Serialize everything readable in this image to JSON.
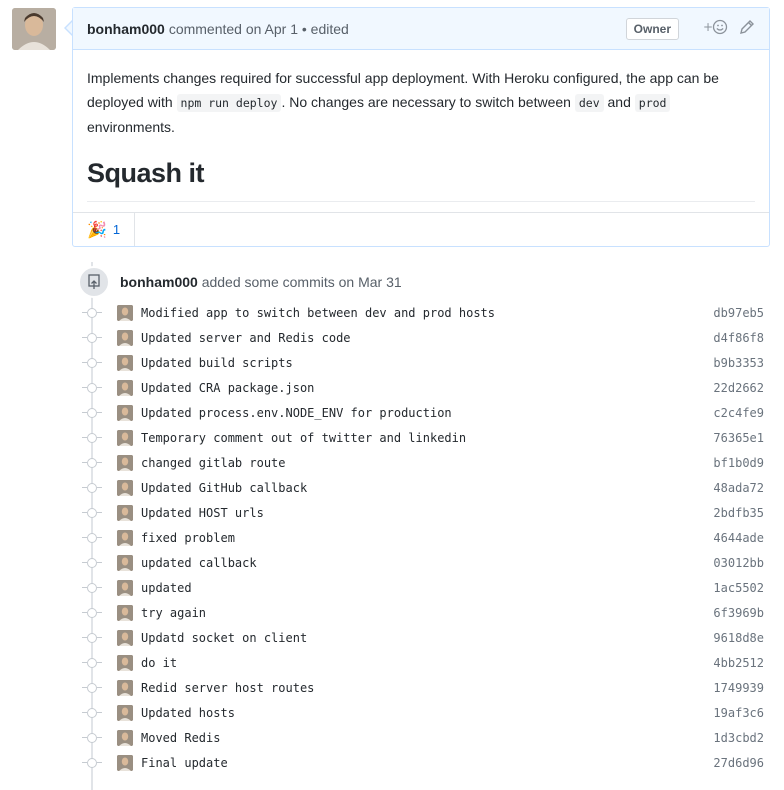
{
  "comment": {
    "author": "bonham000",
    "meta": "commented on Apr 1 • edited",
    "owner_badge": "Owner",
    "emoji_icon": "smiley-add-icon",
    "edit_icon": "pencil-icon",
    "body": {
      "p1_a": "Implements changes required for successful app deployment. With Heroku configured, the app can be deployed with ",
      "code1": "npm run deploy",
      "p1_b": ". No changes are necessary to switch between ",
      "code2": "dev",
      "p1_c": " and ",
      "code3": "prod",
      "p1_d": " environments.",
      "heading": "Squash it"
    },
    "reaction": {
      "emoji": "🎉",
      "count": "1"
    }
  },
  "commits_event": {
    "author": "bonham000",
    "text": "added some commits on Mar 31"
  },
  "commits": [
    {
      "message": "Modified app to switch between dev and prod hosts",
      "sha": "db97eb5"
    },
    {
      "message": "Updated server and Redis code",
      "sha": "d4f86f8"
    },
    {
      "message": "Updated build scripts",
      "sha": "b9b3353"
    },
    {
      "message": "Updated CRA package.json",
      "sha": "22d2662"
    },
    {
      "message": "Updated process.env.NODE_ENV for production",
      "sha": "c2c4fe9"
    },
    {
      "message": "Temporary comment out of twitter and linkedin",
      "sha": "76365e1"
    },
    {
      "message": "changed gitlab route",
      "sha": "bf1b0d9"
    },
    {
      "message": "Updated GitHub callback",
      "sha": "48ada72"
    },
    {
      "message": "Updated HOST urls",
      "sha": "2bdfb35"
    },
    {
      "message": "fixed problem",
      "sha": "4644ade"
    },
    {
      "message": "updated callback",
      "sha": "03012bb"
    },
    {
      "message": "updated",
      "sha": "1ac5502"
    },
    {
      "message": "try again",
      "sha": "6f3969b"
    },
    {
      "message": "Updatd socket on client",
      "sha": "9618d8e"
    },
    {
      "message": "do it",
      "sha": "4bb2512"
    },
    {
      "message": "Redid server host routes",
      "sha": "1749939"
    },
    {
      "message": "Updated hosts",
      "sha": "19af3c6"
    },
    {
      "message": "Moved Redis",
      "sha": "1d3cbd2"
    },
    {
      "message": "Final update",
      "sha": "27d6d96"
    }
  ]
}
